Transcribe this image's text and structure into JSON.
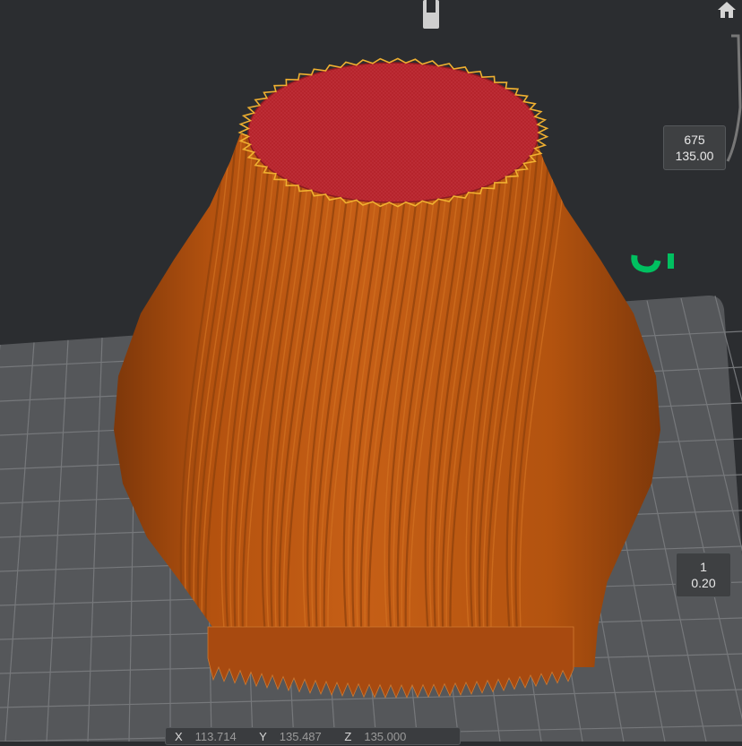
{
  "app": "3D printing slicer preview",
  "colors": {
    "background": "#2b2d30",
    "bed": "#55575a",
    "grid": "#77797c",
    "model": "#bf5a13",
    "model_dark": "#8a3c0b",
    "top_surface": "#b5232b",
    "top_edge": "#f0b030",
    "bed_label": "#00c060"
  },
  "layer_slider": {
    "top": {
      "layer": "675",
      "height": "135.00"
    },
    "bottom": {
      "layer": "1",
      "height": "0.20"
    }
  },
  "coordinates": {
    "x_label": "X",
    "x_value": "113.714",
    "y_label": "Y",
    "y_value": "135.487",
    "z_label": "Z",
    "z_value": "135.000"
  },
  "icons": {
    "home": "home-icon",
    "slider_handle": "slider-handle-icon"
  }
}
